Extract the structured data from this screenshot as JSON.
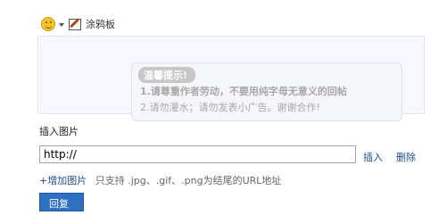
{
  "toolbar": {
    "emoji_icon": "smiley-icon",
    "dropdown_icon": "caret-down-icon",
    "doodle_icon": "pen-board-icon",
    "doodle_label": "涂鸦板"
  },
  "editor": {
    "tip": {
      "title": "温馨提示!",
      "line1": "1.请尊重作者劳动，不要用纯字母无意义的回帖",
      "line2": "2.请勿灌水；请勿发表小广告。谢谢合作!"
    }
  },
  "insert_image": {
    "title": "插入图片",
    "url_value": "http://",
    "insert_label": "插入",
    "delete_label": "删除",
    "add_link": "+增加图片",
    "hint": "只支持 .jpg、.gif、.png为结尾的URL地址"
  },
  "reply_button": "回复",
  "colors": {
    "link": "#1f4c8f",
    "button": "#2d70c4"
  }
}
